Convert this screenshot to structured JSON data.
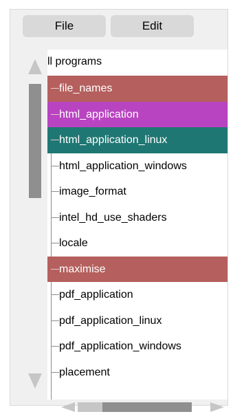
{
  "menu": {
    "file_label": "File",
    "edit_label": "Edit"
  },
  "tree": {
    "header": "ll programs",
    "items": [
      {
        "label": "file_names",
        "highlight": "#b5605e"
      },
      {
        "label": "html_application",
        "highlight": "#b944c1"
      },
      {
        "label": "html_application_linux",
        "highlight": "#1f7773"
      },
      {
        "label": "html_application_windows",
        "highlight": ""
      },
      {
        "label": "image_format",
        "highlight": ""
      },
      {
        "label": "intel_hd_use_shaders",
        "highlight": ""
      },
      {
        "label": "locale",
        "highlight": ""
      },
      {
        "label": "maximise",
        "highlight": "#b5605e"
      },
      {
        "label": "pdf_application",
        "highlight": ""
      },
      {
        "label": "pdf_application_linux",
        "highlight": ""
      },
      {
        "label": "pdf_application_windows",
        "highlight": ""
      },
      {
        "label": "placement",
        "highlight": ""
      }
    ],
    "highlight_text_color": "#ffffff"
  },
  "scrollbars": {
    "vertical": {
      "up_icon": "triangle-up-icon",
      "down_icon": "triangle-down-icon"
    },
    "horizontal": {
      "left_icon": "triangle-left-icon",
      "right_icon": "triangle-right-icon"
    }
  }
}
